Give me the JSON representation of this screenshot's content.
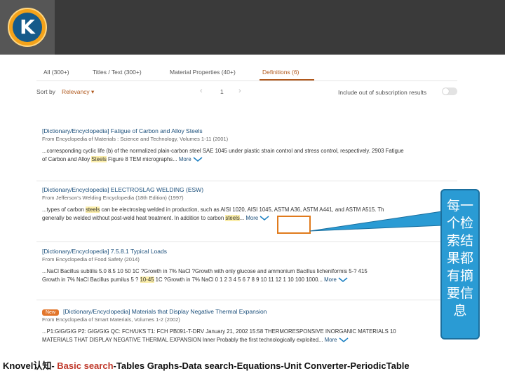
{
  "header": {
    "logo_letter": "K",
    "logo_colors": {
      "ring": "#f3a21a",
      "core": "#155a8a"
    }
  },
  "tabs": [
    {
      "label": "All (300+)"
    },
    {
      "label": "Titles / Text (300+)"
    },
    {
      "label": "Material Properties (40+)"
    },
    {
      "label": "Definitions (6)",
      "active": true
    }
  ],
  "sort": {
    "label": "Sort by",
    "value": "Relevancy ▾",
    "page": "1",
    "include_label": "Include out of subscription results"
  },
  "results": [
    {
      "title": "[Dictionary/Encyclopedia] Fatigue of Carbon and Alloy Steels",
      "source": "From Encyclopedia of Materials : Science and Technology, Volumes 1-11 (2001)",
      "line1": "...corresponding cyclic life (b) of the normalized plain-carbon steel SAE 1045 under plastic strain control and stress control, respectively. 2903 Fatigue",
      "line2_pre": "of Carbon and Alloy ",
      "line2_hl": "Steels",
      "line2_post": " Figure 8 TEM micrographs...",
      "more": "More"
    },
    {
      "title": "[Dictionary/Encyclopedia] ELECTROSLAG WELDING (ESW)",
      "source": "From Jefferson's Welding Encyclopedia (18th Edition) (1997)",
      "line1_pre": "...types of carbon ",
      "line1_hl": "steels",
      "line1_post": " can be electroslag welded in production, such as AISI 1020, AISI 1045, ASTM A36, ASTM A441, and ASTM A515. Th",
      "line2_pre": "generally be welded without post-weld heat treatment. In addition to carbon ",
      "line2_hl": "steels",
      "line2_post": "...",
      "more": "More"
    },
    {
      "title": "[Dictionary/Encyclopedia] 7.5.8.1 Typical Loads",
      "source": "From Encyclopedia of Food Safety (2014)",
      "line1": "...NaCl Bacillus subtilis 5.0 8.5 10 50 1C ?Growth in 7% NaCl ?Growth with only glucose and ammonium Bacillus licheniformis 5-? 415",
      "line2_pre": "Growth in 7% NaCl Bacillus pumilus 5 ? ",
      "line2_hl": "10-45",
      "line2_post": " 1C ?Growth in 7% NaCl 0 1 2 3 4 5 6 7 8 9 10 11 12 1 10 100 1000...",
      "more": "More"
    },
    {
      "badge": "New",
      "title": "[Dictionary/Encyclopedia] Materials that Display Negative Thermal Expansion",
      "source": "From Encyclopedia of Smart Materials, Volumes 1-2 (2002)",
      "line1": "...P1:GIG/GIG P2: GIG/GIG QC: FCH/UKS T1: FCH PB091-T-DRV January 21, 2002 15:58 THERMORESPONSIVE INORGANIC MATERIALS 10",
      "line2": "MATERIALS THAT DISPLAY NEGATIVE THERMAL EXPANSION Inner Probably the first technologically exploited...",
      "more": "More"
    }
  ],
  "callout": {
    "text": "每一个检索结果都有摘要信息",
    "color": "#2a9bd4"
  },
  "caption": {
    "prefix": "Knovel认知- ",
    "highlight": "Basic search",
    "suffix": "-Tables Graphs-Data search-Equations-Unit Converter-PeriodicTable"
  }
}
